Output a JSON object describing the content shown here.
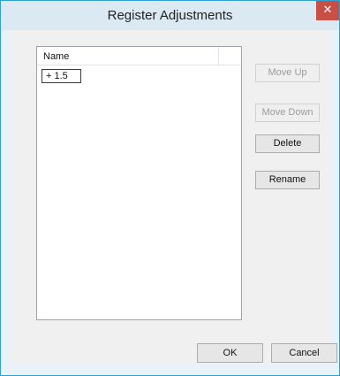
{
  "window": {
    "title": "Register Adjustments",
    "close_icon": "close-icon"
  },
  "list": {
    "column_header": "Name",
    "items": [
      {
        "value": "+ 1.5"
      }
    ]
  },
  "buttons": {
    "move_up": "Move Up",
    "move_down": "Move Down",
    "delete": "Delete",
    "rename": "Rename",
    "ok": "OK",
    "cancel": "Cancel"
  },
  "colors": {
    "accent": "#2f9fd6",
    "close": "#c74f45"
  }
}
